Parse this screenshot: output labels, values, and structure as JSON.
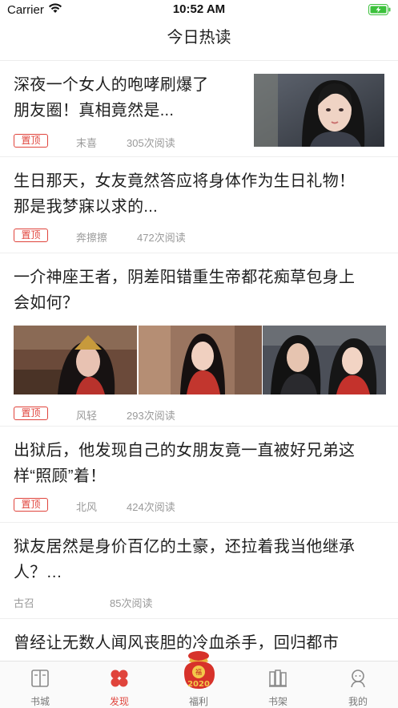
{
  "status_bar": {
    "carrier": "Carrier",
    "time": "10:52 AM"
  },
  "nav": {
    "title": "今日热读"
  },
  "feed": [
    {
      "title_lines": [
        "深夜一个女人的咆哮刷爆了",
        "朋友圈！真相竟然是..."
      ],
      "badge": "置顶",
      "author": "末喜",
      "reads": "305次阅读"
    },
    {
      "title_lines": [
        "生日那天，女友竟然答应将身体作为生日礼物！",
        "那是我梦寐以求的..."
      ],
      "badge": "置顶",
      "author": "奔擦擦",
      "reads": "472次阅读"
    },
    {
      "title_lines": [
        "一介神座王者，阴差阳错重生帝都花痴草包身上",
        "会如何？"
      ],
      "badge": "置顶",
      "author": "风轻",
      "reads": "293次阅读"
    },
    {
      "title_lines": [
        "出狱后，他发现自己的女朋友竟一直被好兄弟这",
        "样“照顾”着！"
      ],
      "badge": "置顶",
      "author": "北风",
      "reads": "424次阅读"
    },
    {
      "title_lines": [
        "狱友居然是身价百亿的土豪，还拉着我当他继承",
        "人？…"
      ],
      "author": "古召",
      "reads": "85次阅读"
    },
    {
      "title_lines": [
        "曾经让无数人闻风丧胆的冷血杀手，回归都市"
      ]
    }
  ],
  "tabbar": {
    "tabs": [
      {
        "label": "书城",
        "icon": "book-city-icon"
      },
      {
        "label": "发现",
        "icon": "discover-icon",
        "active": true
      },
      {
        "label": "福利",
        "icon": "lucky-bag-icon",
        "badge_text": "2020"
      },
      {
        "label": "书架",
        "icon": "bookshelf-icon"
      },
      {
        "label": "我的",
        "icon": "profile-icon"
      }
    ]
  },
  "colors": {
    "accent": "#e0443c",
    "text": "#1f1f1f",
    "meta": "#9a9a9a",
    "battery": "#3cc13c"
  }
}
